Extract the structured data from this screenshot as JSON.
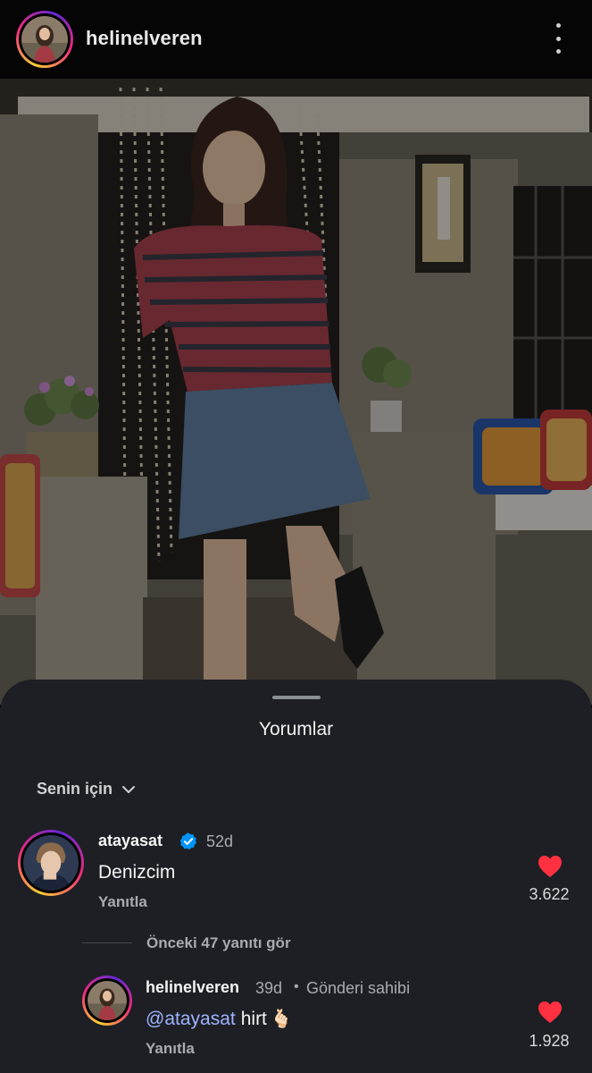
{
  "header": {
    "username": "helinelveren",
    "avatar_icon": "profile-photo-avatar",
    "more_icon": "more-vertical-icon"
  },
  "post": {
    "image_description": "photo"
  },
  "comments_sheet": {
    "title": "Yorumlar",
    "filter_label": "Senin için",
    "comments": [
      {
        "username": "atayasat",
        "verified": true,
        "time": "52d",
        "text": "Denizcim",
        "reply_label": "Yanıtla",
        "likes": "3.622"
      }
    ],
    "view_previous": "Önceki 47 yanıtı gör",
    "replies": [
      {
        "username": "helinelveren",
        "time": "39d",
        "separator": "•",
        "owner_label": "Gönderi sahibi",
        "mention": "@atayasat",
        "text": "hirt",
        "emoji": "🫰🏻",
        "reply_label": "Yanıtla",
        "likes": "1.928"
      }
    ]
  },
  "colors": {
    "sheet_bg": "#1d1f24",
    "heart": "#ff3040",
    "mention": "#9fb3ff",
    "verified": "#0095f6"
  }
}
